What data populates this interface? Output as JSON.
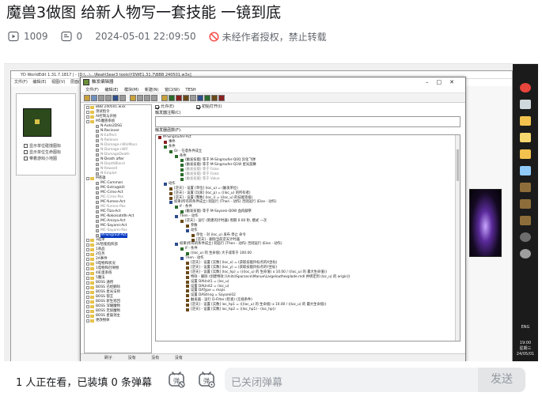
{
  "header": {
    "title": "魔兽3做图 给新人物写一套技能 一镜到底",
    "views": "1009",
    "danmaku_count": "0",
    "date": "2024-05-01 22:09:50",
    "copyright_notice": "未经作者授权，禁止转载"
  },
  "video": {
    "worldedit": {
      "title": "YD WorldEdit 1.31.7.1817 | - [D:\\...\\...\\Reali\\Sear3 tools\\YDWE1.31.7\\BBB 240501.w3x]",
      "menu": [
        "文件(F)",
        "编辑(E)",
        "视图(V)",
        "层面(L)"
      ],
      "checkboxes": [
        "显示单位碰撞图标",
        "显示单位生命图标",
        "带着游戏小地图"
      ]
    },
    "trigger_editor": {
      "title": "触发编辑器",
      "menu": [
        "文件(F)",
        "编辑(E)",
        "模块(M)",
        "新建(N)",
        "窗口(W)",
        "TESH"
      ],
      "enabled_label": "允许(E)",
      "initially_on_label": "初始打开(I)",
      "comment_label": "触发器注释(C)",
      "function_label": "触发器函数(F):",
      "tree": [
        {
          "label": "BBB 240501.w3x",
          "kind": "map",
          "dim": false
        },
        {
          "label": "测试指令",
          "kind": "folder",
          "dim": false
        },
        {
          "label": "AI控制与开始",
          "kind": "folder",
          "dim": false
        },
        {
          "label": "M5魔兽系统",
          "kind": "folder",
          "dim": false
        },
        {
          "label": "N-Auto2DSG",
          "kind": "trigger",
          "dim": false
        },
        {
          "label": "N-Reciever",
          "kind": "trigger",
          "dim": false
        },
        {
          "label": "N-Eaffect",
          "kind": "trigger",
          "dim": true
        },
        {
          "label": "N-Reliever",
          "kind": "trigger",
          "dim": true
        },
        {
          "label": "N-Damage+WinMacs",
          "kind": "trigger",
          "dim": true
        },
        {
          "label": "N-Damage+Wif",
          "kind": "trigger",
          "dim": true
        },
        {
          "label": "N-DamageDeath",
          "kind": "trigger",
          "dim": true
        },
        {
          "label": "N-Death after",
          "kind": "trigger",
          "dim": false
        },
        {
          "label": "N-DepthBlend",
          "kind": "trigger",
          "dim": true
        },
        {
          "label": "N-Reward",
          "kind": "trigger",
          "dim": true
        },
        {
          "label": "N-Emplot",
          "kind": "trigger",
          "dim": true
        },
        {
          "label": "M英雄",
          "kind": "folder",
          "dim": false
        },
        {
          "label": "MC-Common",
          "kind": "trigger",
          "dim": false
        },
        {
          "label": "MC-Extra@kill",
          "kind": "trigger",
          "dim": false
        },
        {
          "label": "MC-Cirno-Act",
          "kind": "trigger",
          "dim": false
        },
        {
          "label": "MC-Cirno-Pas",
          "kind": "trigger",
          "dim": true
        },
        {
          "label": "MC-Yumeo-Act",
          "kind": "trigger",
          "dim": false
        },
        {
          "label": "MC-Yumeo-Pas",
          "kind": "trigger",
          "dim": true
        },
        {
          "label": "MC-Tiza-Act",
          "kind": "trigger",
          "dim": false
        },
        {
          "label": "MC-Kokoisatdtk-Act",
          "kind": "trigger",
          "dim": false
        },
        {
          "label": "MC-Anizya-Act",
          "kind": "trigger",
          "dim": false
        },
        {
          "label": "MC-Sayarei-Act",
          "kind": "trigger",
          "dim": false
        },
        {
          "label": "MC-Sayarei-Pas",
          "kind": "trigger",
          "dim": true
        },
        {
          "label": "M-Singrouf-Act",
          "kind": "trigger",
          "dim": false,
          "selected": true
        },
        {
          "label": "3选单",
          "kind": "folder",
          "dim": false
        },
        {
          "label": "3V智能指挥部",
          "kind": "folder",
          "dim": false
        },
        {
          "label": "1商品",
          "kind": "folder",
          "dim": false
        },
        {
          "label": "2任务",
          "kind": "folder",
          "dim": false
        },
        {
          "label": "2A事件",
          "kind": "folder",
          "dim": false
        },
        {
          "label": "0电物和状况",
          "kind": "folder",
          "dim": false
        },
        {
          "label": "1电物和召唤物",
          "kind": "folder",
          "dim": false
        },
        {
          "label": "4彩蛋系统",
          "kind": "folder",
          "dim": false
        },
        {
          "label": "5魔法",
          "kind": "folder",
          "dim": false
        },
        {
          "label": "BOSS 通用",
          "kind": "folder",
          "dim": false
        },
        {
          "label": "BOSS 已经删除",
          "kind": "folder",
          "dim": false
        },
        {
          "label": "BOSS 星光法师",
          "kind": "folder",
          "dim": false
        },
        {
          "label": "BOSS 郁王",
          "kind": "folder",
          "dim": false
        },
        {
          "label": "BOSS 新生巡回",
          "kind": "folder",
          "dim": false
        },
        {
          "label": "BOSS 深耀魔物",
          "kind": "folder",
          "dim": false
        },
        {
          "label": "BOSS 无垠魔物",
          "kind": "folder",
          "dim": false
        },
        {
          "label": "BOSS 星辰领主",
          "kind": "folder",
          "dim": false
        },
        {
          "label": "更改物体",
          "kind": "folder",
          "dim": false
        }
      ],
      "functions": [
        {
          "t": "M-Singroufer-Act",
          "d": 0,
          "c": "#8a2020"
        },
        {
          "t": "事件",
          "d": 1,
          "c": "#8a2020"
        },
        {
          "t": "条件",
          "d": 1,
          "c": "#2c6c2c"
        },
        {
          "t": "Or - 任意条件成立",
          "d": 2,
          "c": "#2c6c2c"
        },
        {
          "t": "条件",
          "d": 3,
          "c": "#2c6c2c"
        },
        {
          "t": "(触发技能) 等于 M-Singroufer-Q0Q 异化飞弹",
          "d": 4,
          "c": "#2c6c2c"
        },
        {
          "t": "(触发技能) 等于 M-Singroufer-Q1W 星光旋舞",
          "d": 4,
          "c": "#2c6c2c"
        },
        {
          "t": "(触发技能) 等于 False",
          "d": 4,
          "c": "#2c6c2c",
          "dim": true
        },
        {
          "t": "(触发技能) 等于 False",
          "d": 4,
          "c": "#2c6c2c",
          "dim": true
        },
        {
          "t": "(触发技能) 等于 Value",
          "d": 4,
          "c": "#2c6c2c",
          "dim": true
        },
        {
          "t": "动作",
          "d": 1,
          "c": "#2c4c8c"
        },
        {
          "t": "[逆天] - 设置 [单位] (loc_u) = (触发单位)",
          "d": 2,
          "c": "#6b4a1a"
        },
        {
          "t": "[逆天] - 设置 [玩家] (loc_p) = ((loc_u) 的所有者)",
          "d": 2,
          "c": "#6b4a1a"
        },
        {
          "t": "[逆天] - 设置 [整数] (loc_i) = ((loc_u) 的技能等级)",
          "d": 2,
          "c": "#6b4a1a"
        },
        {
          "t": "如果(所有的条件成立) 则运行 (Then - 动作) 否则运行 (Else - 动作)",
          "d": 2,
          "c": "#2c4c8c"
        },
        {
          "t": "If - 条件",
          "d": 3,
          "c": "#2c6c2c"
        },
        {
          "t": "(触发技能) 等于 M-Sayarei-Q0W 血肉献祭",
          "d": 4,
          "c": "#2c6c2c"
        },
        {
          "t": "Then - 动作",
          "d": 3,
          "c": "#2c4c8c"
        },
        {
          "t": "[逆天] - 运行 (新建的计时器) 周期 0.00 秒, 模式 一次",
          "d": 4,
          "c": "#6b4a1a"
        },
        {
          "t": "参数",
          "d": 5,
          "c": "#6b4a1a"
        },
        {
          "t": "动作",
          "d": 5,
          "c": "#2c4c8c"
        },
        {
          "t": "单位 - 对 (loc_u) 发布 停止 命令",
          "d": 6,
          "c": "#6b4a1a"
        },
        {
          "t": "[逆天] - 删除当前逆天计时器",
          "d": 6,
          "c": "#6b4a1a"
        },
        {
          "t": "如果(所有的条件成立) 则运行 (Then - 动作) 否则运行 (Else - 动作)",
          "d": 3,
          "c": "#2c4c8c"
        },
        {
          "t": "If - 条件",
          "d": 4,
          "c": "#2c6c2c"
        },
        {
          "t": "((loc_u) 的 生命值) 大于或等于 100.00",
          "d": 5,
          "c": "#2c6c2c"
        },
        {
          "t": "Then - 动作",
          "d": 4,
          "c": "#2c4c8c"
        },
        {
          "t": "[逆天] - 设置 [实数] (loc_x) = (获取技能目标点的X坐标)",
          "d": 5,
          "c": "#6b4a1a"
        },
        {
          "t": "[逆天] - 设置 [实数] (loc_y) = (获取技能目标点的Y坐标)",
          "d": 5,
          "c": "#6b4a1a"
        },
        {
          "t": "[逆天] - 设置 [实数] (loc_hp) = (((loc_u) 的 生命值) x 10.00 / ((loc_u) 的 最大生命值))",
          "d": 5,
          "c": "#6b4a1a"
        },
        {
          "t": "特效 - 删除 (创建特效 [Units\\Sparance\\Manue\\Largelouthexplode.mdl 并绑定到 (loc_u) 的 origin])",
          "d": 5,
          "c": "#6b4a1a"
        },
        {
          "t": "设置 DAUnit1 = (loc_u)",
          "d": 5,
          "c": "#6b4a1a"
        },
        {
          "t": "设置 DAUnit2 = (loc_u)",
          "d": 5,
          "c": "#6b4a1a"
        },
        {
          "t": "设置 DAType = majis",
          "d": 5,
          "c": "#6b4a1a"
        },
        {
          "t": "设置 DAString = Sayarei02",
          "d": 5,
          "c": "#6b4a1a"
        },
        {
          "t": "触发器 - 运行 D-Filter (检查) (无视条件)",
          "d": 5,
          "c": "#6b4a1a"
        },
        {
          "t": "[逆天] - 设置 [实数] loc_hp1 = (((loc_u) 的 生命值) x 10.00 / ((loc_u) 的 最大生命值))",
          "d": 5,
          "c": "#6b4a1a"
        },
        {
          "t": "[逆天] - 设置 [实数] loc_hp2 = ((loc_hp1) - (loc_hp))",
          "d": 5,
          "c": "#6b4a1a"
        }
      ],
      "status": [
        "刷子",
        "没有",
        "没有",
        "没有"
      ]
    },
    "taskbar": {
      "items": [
        {
          "icon": "chrome-icon",
          "color": "#e8453c"
        },
        {
          "icon": "window-icon",
          "color": "#cfd8dc"
        },
        {
          "icon": "folder-icon",
          "color": "#f2c14e"
        },
        {
          "icon": "notes-icon",
          "color": "#f5d76e"
        },
        {
          "icon": "folder-icon",
          "color": "#f2c14e"
        },
        {
          "icon": "editor-icon",
          "color": "#90caf9"
        },
        {
          "icon": "warcraft-icon",
          "color": "#8d6e3a"
        },
        {
          "icon": "warcraft-icon",
          "color": "#8d6e3a"
        },
        {
          "icon": "warcraft-icon",
          "color": "#8d6e3a"
        },
        {
          "icon": "obs-icon",
          "color": "#6d6d6d"
        },
        {
          "icon": "sync-icon",
          "color": "#9e9e9e"
        }
      ],
      "tray_lang": "ENG",
      "clock_time": "19:00",
      "clock_day": "星期三",
      "clock_date": "24/05/01"
    }
  },
  "bottom": {
    "viewers": "1 人正在看，已装填 0 条弹幕",
    "input_placeholder": "已关闭弹幕",
    "send_label": "发送"
  }
}
